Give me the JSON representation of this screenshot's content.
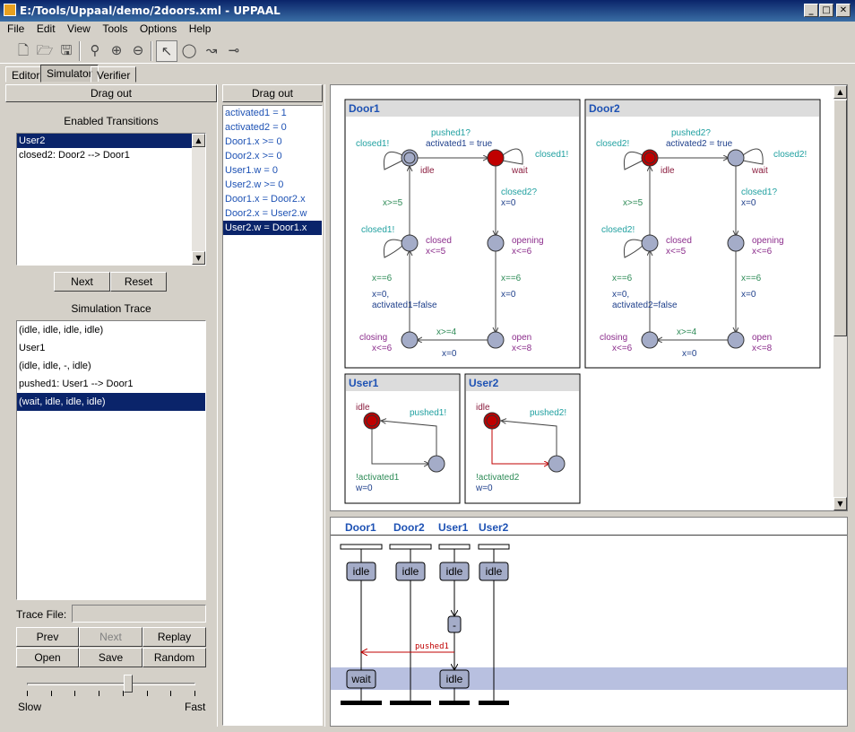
{
  "window": {
    "title": "E:/Tools/Uppaal/demo/2doors.xml - UPPAAL",
    "min": "_",
    "max": "□",
    "close": "✕"
  },
  "menu": [
    "File",
    "Edit",
    "View",
    "Tools",
    "Options",
    "Help"
  ],
  "toolbar": [
    "new-file-icon",
    "open-file-icon",
    "save-icon",
    "zoom-icon",
    "zoom-in-icon",
    "zoom-out-icon",
    "select-tool-icon",
    "location-tool-icon",
    "edge-tool-icon",
    "nail-tool-icon"
  ],
  "tabs": [
    {
      "label": "Editor"
    },
    {
      "label": "Simulator",
      "selected": true
    },
    {
      "label": "Verifier"
    }
  ],
  "left": {
    "drag_out": "Drag out",
    "enabled_title": "Enabled Transitions",
    "enabled": [
      "User2",
      "closed2: Door2 --> Door1"
    ],
    "next": "Next",
    "reset": "Reset",
    "trace_title": "Simulation Trace",
    "trace": [
      "(idle, idle, idle, idle)",
      "User1",
      "(idle, idle, -, idle)",
      "pushed1: User1 --> Door1",
      "(wait, idle, idle, idle)"
    ],
    "trace_file_label": "Trace File:",
    "trace_file_value": "",
    "prev": "Prev",
    "next2": "Next",
    "replay": "Replay",
    "open": "Open",
    "save": "Save",
    "random": "Random",
    "slow": "Slow",
    "fast": "Fast",
    "speed": 0.6
  },
  "vars": {
    "drag_out": "Drag out",
    "items": [
      "activated1 = 1",
      "activated2 = 0",
      "Door1.x >= 0",
      "Door2.x >= 0",
      "User1.w = 0",
      "User2.w >= 0",
      "Door1.x = Door2.x",
      "Door2.x = User2.w",
      "User2.w = Door1.x"
    ]
  },
  "door1": {
    "title": "Door1",
    "pushed": "pushed1?",
    "activated": "activated1 = true",
    "closedL": "closed1!",
    "closedR": "closed1!",
    "idle": "idle",
    "wait": "wait",
    "closedOther": "closed2?",
    "x0a": "x=0",
    "xge5": "x>=5",
    "closedSelf": "closed1!",
    "closed": "closed",
    "xle5": "x<=5",
    "opening": "opening",
    "xle6a": "x<=6",
    "xeq6a": "x==6",
    "xeq6b": "x==6",
    "x0b": "x=0,",
    "actf": "activated1=false",
    "x0c": "x=0",
    "closing": "closing",
    "xle6b": "x<=6",
    "xge4": "x>=4",
    "open": "open",
    "xle8": "x<=8",
    "x0d": "x=0"
  },
  "door2": {
    "title": "Door2",
    "pushed": "pushed2?",
    "activated": "activated2 = true",
    "closedL": "closed2!",
    "closedR": "closed2!",
    "idle": "idle",
    "wait": "wait",
    "closedOther": "closed1?",
    "x0a": "x=0",
    "xge5": "x>=5",
    "closedSelf": "closed2!",
    "closed": "closed",
    "xle5": "x<=5",
    "opening": "opening",
    "xle6a": "x<=6",
    "xeq6a": "x==6",
    "xeq6b": "x==6",
    "x0b": "x=0,",
    "actf": "activated2=false",
    "x0c": "x=0",
    "closing": "closing",
    "xle6b": "x<=6",
    "xge4": "x>=4",
    "open": "open",
    "xle8": "x<=8",
    "x0d": "x=0"
  },
  "user1": {
    "title": "User1",
    "idle": "idle",
    "pushed": "pushed1!",
    "guard": "!activated1",
    "reset": "w=0"
  },
  "user2": {
    "title": "User2",
    "idle": "idle",
    "pushed": "pushed2!",
    "guard": "!activated2",
    "reset": "w=0"
  },
  "msc": {
    "columns": [
      "Door1",
      "Door2",
      "User1",
      "User2"
    ],
    "row1": [
      "idle",
      "idle",
      "idle",
      "idle"
    ],
    "mid": "-",
    "message": "pushed1",
    "row2": [
      "wait",
      "idle"
    ]
  },
  "colors": {
    "active_location": "#c00000",
    "location": "#a4acc8",
    "selection": "#0a246a",
    "msc_highlight": "#b8c0e0"
  }
}
